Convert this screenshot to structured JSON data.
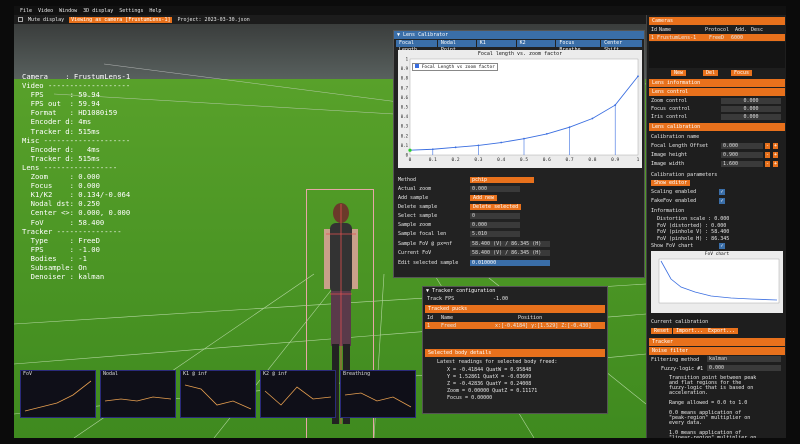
{
  "menu": [
    "File",
    "Video",
    "Window",
    "3D display",
    "Settings",
    "Help"
  ],
  "toolbar": {
    "mute_label": "Mute display",
    "viewing_label": "Viewing as camera [FrustumLens-1]",
    "project_label": "Project: 2023-03-30.json"
  },
  "overlay": {
    "lines": [
      "Camera    : FrustumLens-1",
      "Video -------------------",
      "  FPS      : 59.94",
      "  FPS out  : 59.94",
      "  Format   : HD1080i59",
      "  Encoder d: 4ms",
      "  Tracker d: 515ms",
      "Misc --------------------",
      "  Encoder d:   4ms",
      "  Tracker d: 515ms",
      "Lens -----------------",
      "  Zoom     : 0.000",
      "  Focus    : 0.000",
      "  K1/K2    : 0.134/-0.064",
      "  Nodal dst: 0.250",
      "  Center <>: 0.000, 0.000",
      "  FoV      : 58.400",
      "Tracker ---------------",
      "  Type     : FreeD",
      "  FPS      : -1.00",
      "  Bodies   : -1",
      "  Subsample: On",
      "  Denoiser : kalman"
    ]
  },
  "lens_calibrator": {
    "title": "Lens Calibrator",
    "tabs": [
      "Focal Length",
      "Nodal Point",
      "K1",
      "K2",
      "Focus Breathe",
      "Center Shift"
    ],
    "chart_title": "Focal length vs. zoom factor",
    "legend": "Focal Length vs zoom factor",
    "method_label": "Method",
    "method_value": "pchip",
    "rows": [
      {
        "label": "Actual zoom",
        "value": "0.000"
      },
      {
        "label": "Add sample",
        "value": "Add new"
      },
      {
        "label": "Delete sample",
        "value": "Delete selected"
      },
      {
        "label": "Select sample",
        "value": "0"
      },
      {
        "label": "Sample zoom",
        "value": "0.000"
      },
      {
        "label": "Sample focal len",
        "value": "5.010"
      },
      {
        "label": "Sample FoV @ px=nf",
        "value": "58.400 (V) / 86.345 (H)"
      },
      {
        "label": "Current FoV",
        "value": "58.400 (V) / 86.345 (H)"
      },
      {
        "label": "Edit selected sample",
        "value": "0.010000"
      }
    ]
  },
  "chart_data": {
    "type": "line",
    "title": "Focal length vs. zoom factor",
    "xlabel": "",
    "ylabel": "",
    "xlim": [
      0,
      1
    ],
    "ylim": [
      0,
      1
    ],
    "x_ticks": [
      "0",
      "0.1",
      "0.2",
      "0.3",
      "0.4",
      "0.5",
      "0.6",
      "0.7",
      "0.8",
      "0.9",
      "1"
    ],
    "y_ticks": [
      "0",
      "0.1",
      "0.2",
      "0.3",
      "0.4",
      "0.5",
      "0.6",
      "0.7",
      "0.8",
      "0.9",
      "1"
    ],
    "series": [
      {
        "name": "Focal Length vs zoom factor",
        "x": [
          0,
          0.1,
          0.2,
          0.3,
          0.4,
          0.5,
          0.6,
          0.7,
          0.8,
          0.9,
          1.0
        ],
        "y": [
          0.05,
          0.06,
          0.08,
          0.1,
          0.13,
          0.17,
          0.22,
          0.29,
          0.38,
          0.52,
          0.82
        ]
      }
    ]
  },
  "tracker_config": {
    "title": "Tracker configuration",
    "track_fps_label": "Track FPS",
    "track_fps_value": "-1.00",
    "tracked_header": "Tracked pucks",
    "cols": [
      "Id",
      "Name",
      "Position"
    ],
    "row": {
      "id": "1",
      "name": "Freed",
      "pos": "x:[-0.4184] y:[1.529] Z:[-0.430]"
    },
    "selected_header": "Selected body details",
    "readings_title": "Latest readings for selected body freed:",
    "readings": [
      "X = -0.41844    QuatW = 0.95848",
      "Y = 1.52861     QuatX = -0.03609",
      "Z = -0.42836    QuatY = 0.24008",
      "Zoom = 0.00000  QuatZ = 0.11171",
      "Focus = 0.00000"
    ]
  },
  "right_panel": {
    "cameras_header": "Cameras",
    "cols": [
      "Id",
      "Name",
      "Protocol",
      "Add.",
      "Desc"
    ],
    "camera_row": {
      "id": "1",
      "name": "FrustumLens-1",
      "proto": "FreeD",
      "addr": "6000"
    },
    "buttons": [
      "New",
      "Del",
      "Focus"
    ],
    "lens_info": "Lens information",
    "lens_control": "Lens control",
    "controls": [
      {
        "label": "Zoom control",
        "value": "0.000"
      },
      {
        "label": "Focus control",
        "value": "0.000"
      },
      {
        "label": "Iris control",
        "value": "0.000"
      }
    ],
    "lens_calibration": "Lens calibration",
    "calibration_name": "Calibration name",
    "calib_rows": [
      {
        "label": "Focal Length Offset",
        "value": "0.000"
      },
      {
        "label": "Image height",
        "value": "0.900"
      },
      {
        "label": "Image width",
        "value": "1.600"
      }
    ],
    "calib_params": "Calibration parameters",
    "show_editor": "Show editor",
    "scaling_enabled": "Scaling enabled",
    "fakefov_enabled": "FakeFov enabled",
    "information": "Information",
    "info_lines": [
      "Distortion scale : 0.000",
      "FoV (distorted)  : 0.000",
      "FoV (pinhole V)  : 58.400",
      "FoV (pinhole H)  : 86.345"
    ],
    "show_fov_chart": "Show FoV chart",
    "fov_chart_title": "FoV chart",
    "current_calibration": "Current calibration",
    "cal_buttons": [
      "Reset",
      "Import...",
      "Export..."
    ],
    "tracker_header": "Tracker",
    "noise_filter": "Noise filter",
    "filtering_method_label": "Filtering method",
    "filtering_method_value": "kalman",
    "fuzzy_label": "Fuzzy-logic #1",
    "fuzzy_value": "0.000",
    "desc_lines": [
      "Transition point between peak",
      "and flat regions for the",
      "fuzzy-logic that is based on",
      "acceleration.",
      "",
      "Range allowed = 0.0 to 1.0",
      "",
      "0.0 means application of",
      "\"peak-region\" multiplier on",
      "every data.",
      "",
      "1.0 means application of",
      "\"linear-region\" multiplier on"
    ]
  },
  "mini_plots": [
    "FoV",
    "Nodal",
    "K1 @ inf",
    "K2 @ inf",
    "Breathing"
  ],
  "accent": "#e8711c",
  "title_blue": "#3a6ea8"
}
